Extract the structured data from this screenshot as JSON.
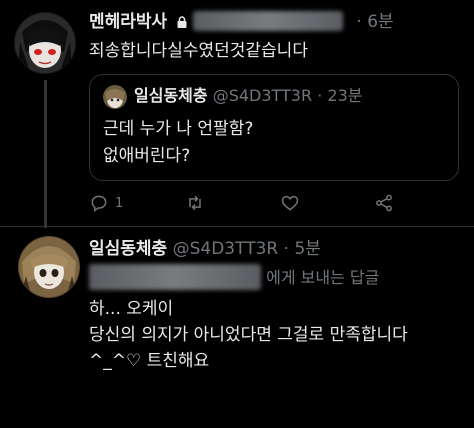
{
  "tweet1": {
    "author_name": "멘헤라박사",
    "time": "6분",
    "text": "죄송합니다실수였던것같습니다",
    "quote": {
      "author_name": "일심동체충",
      "handle": "@S4D3TT3R",
      "dot": "·",
      "time": "23분",
      "line1": "근데 누가 나 언팔함?",
      "line2": "없애버린다?"
    },
    "reply_count": "1",
    "retweet_count": "",
    "like_count": ""
  },
  "tweet2": {
    "author_name": "일심동체충",
    "handle": "@S4D3TT3R",
    "dot": "·",
    "time": "5분",
    "replying_suffix": "에게 보내는 답글",
    "line1": "하... 오케이",
    "line2": "당신의 의지가 아니었다면 그걸로 만족합니다",
    "line3": "^_^♡ 트친해요"
  },
  "icons": [
    "lock-icon",
    "reply-icon",
    "retweet-icon",
    "like-icon",
    "share-icon"
  ],
  "colors": {
    "background": "#000000",
    "text": "#e7e9ea",
    "muted": "#71767b",
    "border": "#2f3336"
  }
}
